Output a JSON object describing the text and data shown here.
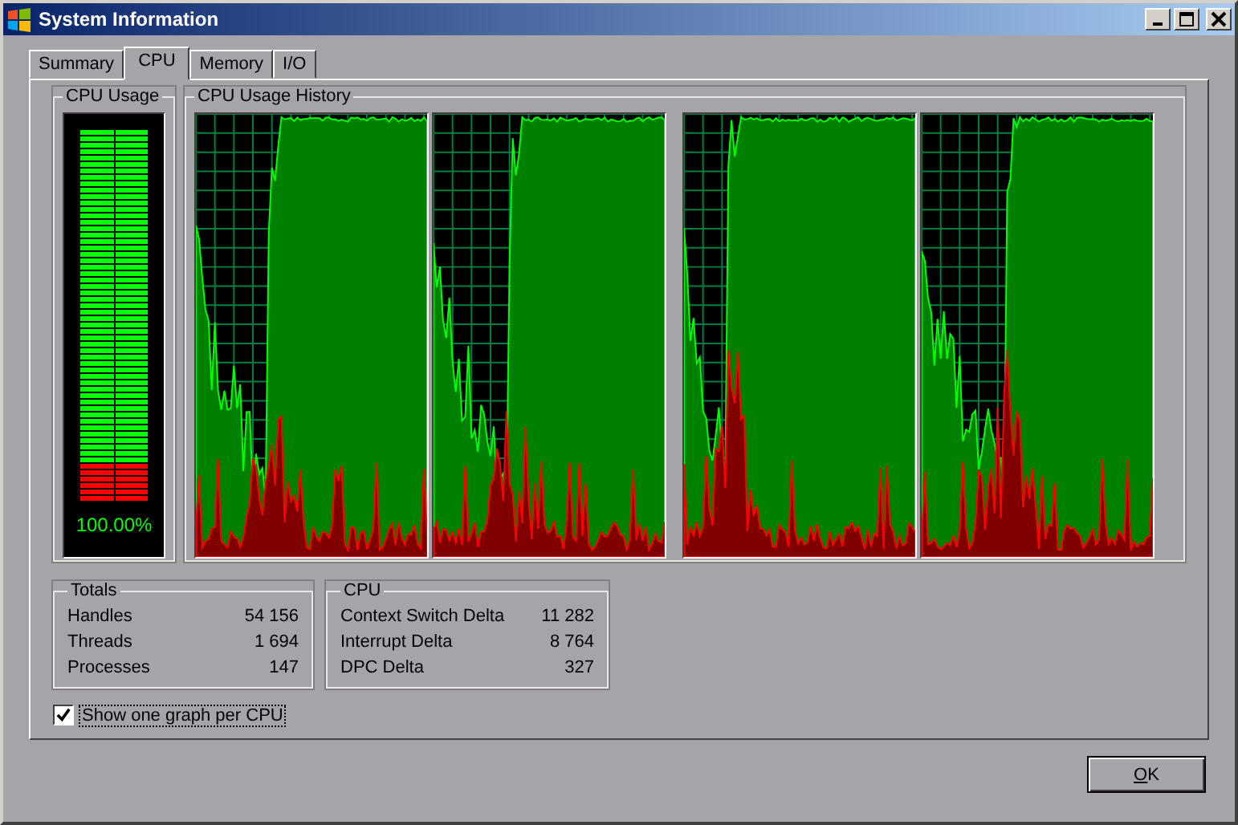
{
  "window": {
    "title": "System Information"
  },
  "tabs": [
    {
      "label": "Summary",
      "selected": false
    },
    {
      "label": "CPU",
      "selected": true
    },
    {
      "label": "Memory",
      "selected": false
    },
    {
      "label": "I/O",
      "selected": false
    }
  ],
  "cpu_usage": {
    "title": "CPU Usage",
    "level": 1,
    "reading": "100.00%"
  },
  "cpu_history": {
    "title": "CPU Usage History"
  },
  "totals": {
    "title": "Totals",
    "rows": [
      {
        "label": "Handles",
        "value": "54 156"
      },
      {
        "label": "Threads",
        "value": "1 694"
      },
      {
        "label": "Processes",
        "value": "147"
      }
    ]
  },
  "cpu": {
    "title": "CPU",
    "rows": [
      {
        "label": "Context Switch Delta",
        "value": "11 282"
      },
      {
        "label": "Interrupt Delta",
        "value": "8 764"
      },
      {
        "label": "DPC Delta",
        "value": "327"
      }
    ]
  },
  "show_one_graph_per_cpu": {
    "label": "Show one graph per CPU",
    "checked": true
  },
  "buttons": [
    "OK"
  ]
}
